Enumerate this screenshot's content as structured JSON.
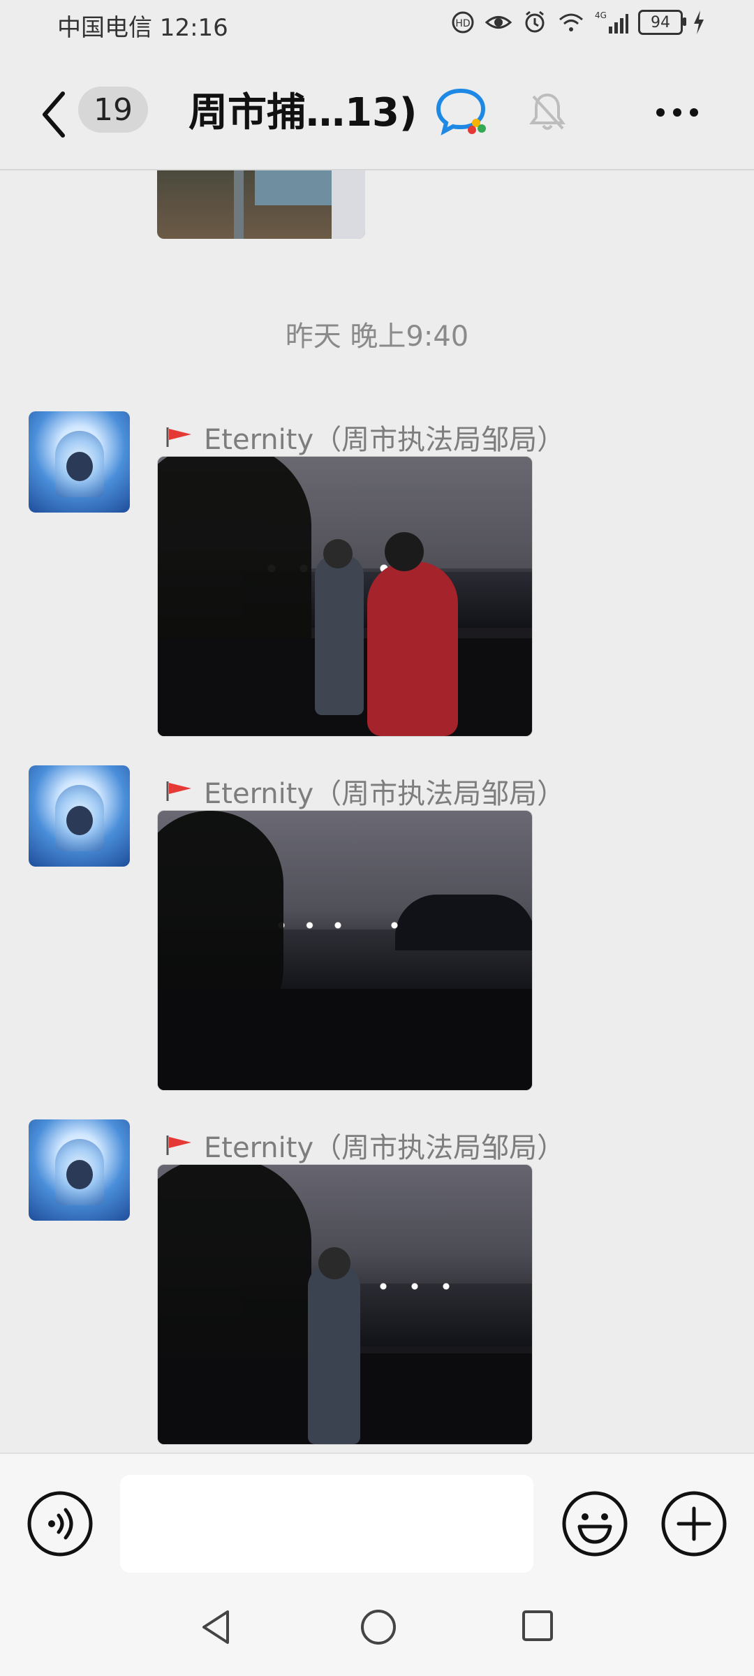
{
  "status_bar": {
    "carrier_time": "中国电信 12:16",
    "network": "4G",
    "battery": "94"
  },
  "header": {
    "unread_count": "19",
    "title": "周市捕…13)"
  },
  "chat": {
    "timestamp": "昨天 晚上9:40",
    "messages": [
      {
        "sender": "Eternity（周市执法局邹局）"
      },
      {
        "sender": "Eternity（周市执法局邹局）"
      },
      {
        "sender": "Eternity（周市执法局邹局）"
      }
    ]
  },
  "input": {
    "placeholder": ""
  },
  "icons": {
    "back": "chevron-left-icon",
    "chat_type": "wecom-chat-icon",
    "mute": "bell-off-icon",
    "more": "more-icon",
    "flag": "red-flag-icon",
    "voice": "voice-icon",
    "emoji": "emoji-icon",
    "plus": "plus-icon"
  },
  "colors": {
    "background": "#ededed",
    "flag_red": "#e53935",
    "chat_icon_blue": "#1e88e5"
  }
}
